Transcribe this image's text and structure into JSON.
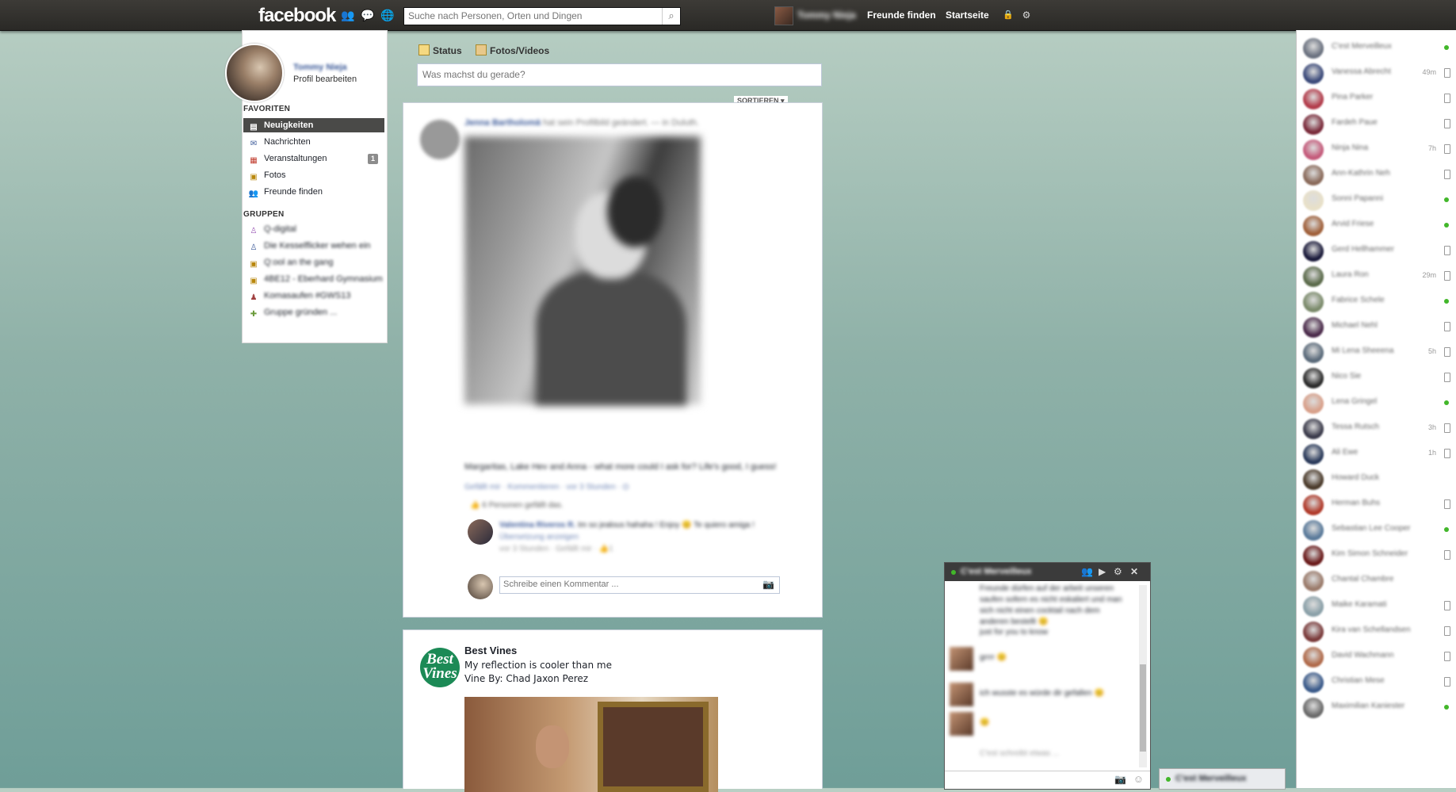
{
  "topbar": {
    "logo": "facebook",
    "search_placeholder": "Suche nach Personen, Orten und Dingen",
    "user_name": "Tommy Nieja",
    "find_friends": "Freunde finden",
    "home": "Startseite"
  },
  "left": {
    "user_name": "Tommy Nieja",
    "edit_profile": "Profil bearbeiten",
    "favorites_heading": "FAVORITEN",
    "favorites": [
      {
        "label": "Neuigkeiten",
        "icon": "news-feed-icon"
      },
      {
        "label": "Nachrichten",
        "icon": "messages-icon"
      },
      {
        "label": "Veranstaltungen",
        "icon": "events-icon",
        "badge": "1"
      },
      {
        "label": "Fotos",
        "icon": "photos-icon"
      },
      {
        "label": "Freunde finden",
        "icon": "find-friends-icon"
      }
    ],
    "groups_heading": "GRUPPEN",
    "groups": [
      {
        "label": "Q-digital"
      },
      {
        "label": "Die Kesselflicker wehen ein"
      },
      {
        "label": "Q:ool an the gang"
      },
      {
        "label": "4BE12 - Eberhard Gymnasium"
      },
      {
        "label": "Komasaufen #GWS13"
      },
      {
        "label": "Gruppe gründen ..."
      }
    ]
  },
  "composer": {
    "status_tab": "Status",
    "photos_tab": "Fotos/Videos",
    "placeholder": "Was machst du gerade?"
  },
  "feed": {
    "sort_label": "SORTIEREN ▾",
    "post1": {
      "author": "Jenna Bartholomä",
      "action": "hat sein Profilbild geändert. — in Duluth.",
      "caption": "Margaritas, Lake Hev and Anna - what more could I ask for? Life's good, I guess!",
      "meta": "Gefällt mir · Kommentieren · vor 3 Stunden · ⛭",
      "likes": "6 Personen gefällt das.",
      "comment_author": "Valentina Riveros R.",
      "comment_text": "Im so jealous hahaha ! Enjoy 😊 Te quiero amiga !",
      "comment_translate": "Übersetzung anzeigen",
      "comment_meta": "vor 3 Stunden · Gefällt mir · 👍1",
      "comment_placeholder": "Schreibe einen Kommentar ..."
    },
    "post2": {
      "page_name": "Best Vines",
      "avatar_text": "Best Vines",
      "line1": "My reflection is cooler than me",
      "line2": "Vine By: Chad Jaxon Perez"
    }
  },
  "chat": {
    "title": "C'est Merveilleux",
    "messages": [
      "Freunde dürfen auf der arbeit unseren saufen sofern es nicht eskaliert und man sich nicht einen cocktail nach dem anderen bestellt 😊",
      "just for you to know",
      "grrrr 😊",
      "ich wusste es würde dir gefallen 😊",
      "😊"
    ],
    "typing": "C'est schreibt etwas ...",
    "second_tab": "C'est Merveilleux"
  },
  "sidebar": {
    "friends": [
      {
        "name": "C'est Merveilleux",
        "status": "online",
        "color": "#6b7280"
      },
      {
        "name": "Vanessa Abrecht",
        "status": "mobile",
        "time": "49m",
        "color": "#3b4a7a"
      },
      {
        "name": "Pina Parker",
        "status": "mobile",
        "color": "#b23b4a"
      },
      {
        "name": "Fardeh Paue",
        "status": "mobile",
        "color": "#7a2a3a"
      },
      {
        "name": "Ninja Nina",
        "status": "mobile",
        "time": "7h",
        "color": "#c45a7a"
      },
      {
        "name": "Ann-Kathrin Neh",
        "status": "mobile",
        "color": "#8a6a5a"
      },
      {
        "name": "Sonni Papanni",
        "status": "online",
        "color": "#e8e0c8"
      },
      {
        "name": "Arvid Friese",
        "status": "online",
        "color": "#a0603a"
      },
      {
        "name": "Gerd Hellhammer",
        "status": "mobile",
        "color": "#1a1a3a"
      },
      {
        "name": "Laura Ron",
        "status": "mobile",
        "time": "29m",
        "color": "#5a6a4a"
      },
      {
        "name": "Fabrice Schele",
        "status": "online",
        "color": "#7a8a6a"
      },
      {
        "name": "Michael Nehl",
        "status": "mobile",
        "color": "#4a2a4a"
      },
      {
        "name": "Mi Lena Sheeena",
        "status": "mobile",
        "time": "5h",
        "color": "#5a6a7a"
      },
      {
        "name": "Nico Sie",
        "status": "mobile",
        "color": "#2a2a2a"
      },
      {
        "name": "Lena Gringel",
        "status": "online",
        "color": "#d8a08a"
      },
      {
        "name": "Tessa Rutsch",
        "status": "mobile",
        "time": "3h",
        "color": "#3a3a4a"
      },
      {
        "name": "Ali Ewe",
        "status": "mobile",
        "time": "1h",
        "color": "#2a3a5a"
      },
      {
        "name": "Howard Duck",
        "status": "none",
        "color": "#4a3a2a"
      },
      {
        "name": "Herman Buhs",
        "status": "mobile",
        "color": "#b03a2a"
      },
      {
        "name": "Sebastian Lee Cooper",
        "status": "online",
        "color": "#5a7a9a"
      },
      {
        "name": "Kim Simon Schneider",
        "status": "mobile",
        "color": "#6a1a1a"
      },
      {
        "name": "Chantal Chambre",
        "status": "none",
        "color": "#9a7a6a"
      },
      {
        "name": "Maike Karamati",
        "status": "mobile",
        "color": "#8aa0a8"
      },
      {
        "name": "Kira van Schellandsen",
        "status": "mobile",
        "color": "#7a3a3a"
      },
      {
        "name": "David Wachmann",
        "status": "mobile",
        "color": "#b06a4a"
      },
      {
        "name": "Christian Mese",
        "status": "mobile",
        "color": "#3a5a8a"
      },
      {
        "name": "Maximilian Kaniester",
        "status": "online",
        "color": "#6a6a6a"
      }
    ]
  },
  "colors": {
    "accent": "#3b5998",
    "online": "#42b72a",
    "topbar": "#343330"
  }
}
